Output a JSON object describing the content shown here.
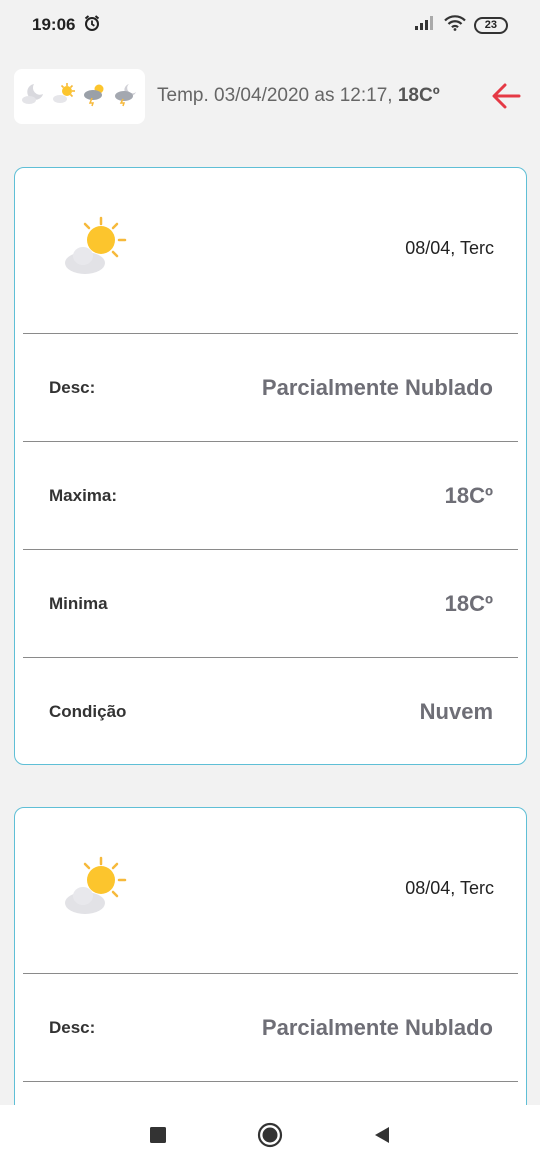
{
  "status_bar": {
    "time": "19:06",
    "battery": "23",
    "icons": [
      "alarm-icon",
      "signal-icon",
      "wifi-icon",
      "battery-icon"
    ]
  },
  "header": {
    "icons": [
      "moon-cloud-icon",
      "sun-cloud-icon",
      "storm-sun-icon",
      "storm-moon-icon"
    ],
    "title_prefix": "Temp. 03/04/2020 as 12:17,",
    "title_temp": "18Cº",
    "back_icon": "arrow-left-icon",
    "accent": "#e53945"
  },
  "colors": {
    "card_border": "#5fbfd6",
    "value_text": "#6e6e76",
    "background": "#f2f2f2"
  },
  "cards": [
    {
      "icon": "partly-cloudy-icon",
      "date": "08/04, Terc",
      "rows": [
        {
          "label": "Desc:",
          "value": "Parcialmente Nublado"
        },
        {
          "label": "Maxima:",
          "value": "18Cº"
        },
        {
          "label": "Minima",
          "value": "18Cº"
        },
        {
          "label": "Condição",
          "value": "Nuvem"
        }
      ]
    },
    {
      "icon": "partly-cloudy-icon",
      "date": "08/04, Terc",
      "rows": [
        {
          "label": "Desc:",
          "value": "Parcialmente Nublado"
        }
      ]
    }
  ],
  "nav_bar": {
    "icons": [
      "recents-square-icon",
      "home-circle-icon",
      "back-triangle-icon"
    ]
  }
}
